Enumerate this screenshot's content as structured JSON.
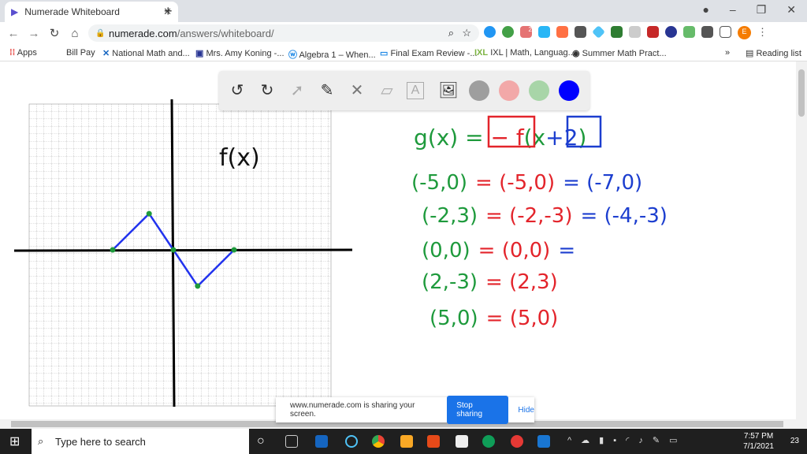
{
  "browser": {
    "tab_title": "Numerade Whiteboard",
    "url_domain": "numerade.com",
    "url_path": "/answers/whiteboard/",
    "profile_initial": "E",
    "ext_badge": "2"
  },
  "bookmarks": [
    "Apps",
    "Bill Pay",
    "National Math and...",
    "Mrs. Amy Koning -...",
    "Algebra 1 – When...",
    "Final Exam Review -...",
    "IXL | Math, Languag...",
    "Summer Math Pract...",
    "Reading list"
  ],
  "toolbar": {
    "colors": [
      "#9e9e9e",
      "#f2a8a8",
      "#a8d5a8",
      "#0000ff"
    ],
    "tools": [
      "undo",
      "redo",
      "select",
      "pen",
      "tools",
      "eraser",
      "text",
      "image"
    ]
  },
  "whiteboard": {
    "graph_label": "f(x)",
    "points": [
      [
        -5,
        0
      ],
      [
        -2,
        3
      ],
      [
        0,
        0
      ],
      [
        2,
        -3
      ],
      [
        5,
        0
      ]
    ],
    "equation": {
      "left": "g(x) = ",
      "neg_f": "− f",
      "mid": "(x",
      "shift": "+2",
      "close": ")"
    },
    "rows": [
      {
        "orig": "(-5,0)",
        "refl": "= (-5,0)",
        "result": "= (-7,0)"
      },
      {
        "orig": "(-2,3)",
        "refl": "= (-2,-3)",
        "result": "= (-4,-3)"
      },
      {
        "orig": "(0,0)",
        "refl": "= (0,0)",
        "result": "="
      },
      {
        "orig": "(2,-3)",
        "refl": "= (2,3)",
        "result": ""
      },
      {
        "orig": "(5,0)",
        "refl": "= (5,0)",
        "result": ""
      }
    ],
    "colors": {
      "green": "#1e9a3c",
      "red": "#e3242b",
      "blue": "#1c3ecf",
      "graph": "#2233ee"
    }
  },
  "share_bar": {
    "message": "www.numerade.com is sharing your screen.",
    "stop": "Stop sharing",
    "hide": "Hide"
  },
  "taskbar": {
    "search_placeholder": "Type here to search",
    "time": "7:57 PM",
    "date": "7/1/2021",
    "notifications": "23"
  }
}
